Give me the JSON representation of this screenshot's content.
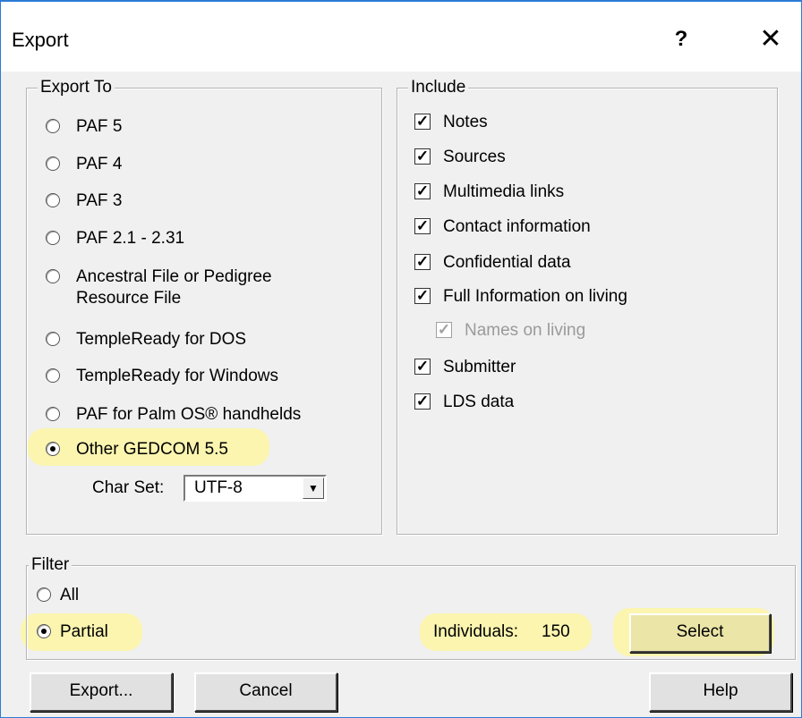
{
  "window": {
    "title": "Export",
    "help_glyph": "?",
    "close_glyph": "✕"
  },
  "export_to": {
    "title": "Export To",
    "options": [
      {
        "label": "PAF 5",
        "selected": false
      },
      {
        "label": "PAF 4",
        "selected": false
      },
      {
        "label": "PAF 3",
        "selected": false
      },
      {
        "label": "PAF 2.1 - 2.31",
        "selected": false
      },
      {
        "label": "Ancestral File or Pedigree",
        "label2": "Resource File",
        "selected": false
      },
      {
        "label": "TempleReady for DOS",
        "selected": false
      },
      {
        "label": "TempleReady for Windows",
        "selected": false
      },
      {
        "label": "PAF for Palm OS® handhelds",
        "selected": false
      },
      {
        "label": "Other GEDCOM 5.5",
        "selected": true
      }
    ],
    "charset_label": "Char Set:",
    "charset_value": "UTF-8",
    "dropdown_glyph": "▼"
  },
  "include": {
    "title": "Include",
    "items": [
      {
        "label": "Notes",
        "checked": true,
        "disabled": false
      },
      {
        "label": "Sources",
        "checked": true,
        "disabled": false
      },
      {
        "label": "Multimedia links",
        "checked": true,
        "disabled": false
      },
      {
        "label": "Contact information",
        "checked": true,
        "disabled": false
      },
      {
        "label": "Confidential data",
        "checked": true,
        "disabled": false
      },
      {
        "label": "Full Information on living",
        "checked": true,
        "disabled": false
      },
      {
        "label": "Names on living",
        "checked": true,
        "disabled": true
      },
      {
        "label": "Submitter",
        "checked": true,
        "disabled": false
      },
      {
        "label": "LDS data",
        "checked": true,
        "disabled": false
      }
    ]
  },
  "filter": {
    "title": "Filter",
    "all_label": "All",
    "partial_label": "Partial",
    "individuals_label": "Individuals:",
    "individuals_count": "150",
    "select_label": "Select"
  },
  "buttons": {
    "export": "Export...",
    "cancel": "Cancel",
    "help": "Help"
  },
  "check_glyph": "✓",
  "highlight_color": "#fbf5b0"
}
